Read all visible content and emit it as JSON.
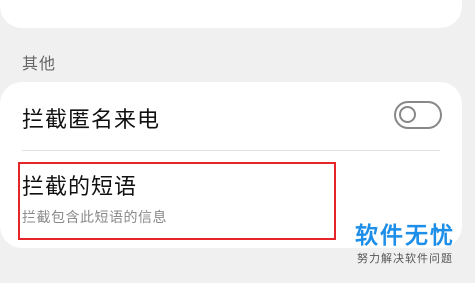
{
  "section": {
    "header": "其他"
  },
  "settings": {
    "anonymous_calls": {
      "label": "拦截匿名来电",
      "enabled": false
    },
    "blocked_phrases": {
      "label": "拦截的短语",
      "description": "拦截包含此短语的信息"
    }
  },
  "annotation": {
    "color": "#e5252a"
  },
  "watermark": {
    "title": "软件无忧",
    "subtitle": "努力解决软件问题",
    "color": "#1e8fe8"
  }
}
